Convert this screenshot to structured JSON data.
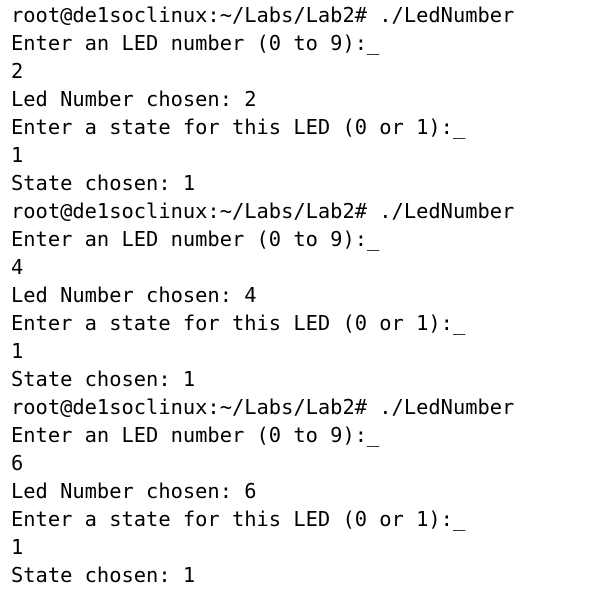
{
  "terminal": {
    "lines": [
      {
        "kind": "prompt",
        "text": "root@de1soclinux:~/Labs/Lab2# ./LedNumber"
      },
      {
        "kind": "output",
        "text": "Enter an LED number (0 to 9):_"
      },
      {
        "kind": "input",
        "text": "2"
      },
      {
        "kind": "output",
        "text": "Led Number chosen: 2"
      },
      {
        "kind": "output",
        "text": "Enter a state for this LED (0 or 1):_"
      },
      {
        "kind": "input",
        "text": "1"
      },
      {
        "kind": "output",
        "text": "State chosen: 1"
      },
      {
        "kind": "prompt",
        "text": "root@de1soclinux:~/Labs/Lab2# ./LedNumber"
      },
      {
        "kind": "output",
        "text": "Enter an LED number (0 to 9):_"
      },
      {
        "kind": "input",
        "text": "4"
      },
      {
        "kind": "output",
        "text": "Led Number chosen: 4"
      },
      {
        "kind": "output",
        "text": "Enter a state for this LED (0 or 1):_"
      },
      {
        "kind": "input",
        "text": "1"
      },
      {
        "kind": "output",
        "text": "State chosen: 1"
      },
      {
        "kind": "prompt",
        "text": "root@de1soclinux:~/Labs/Lab2# ./LedNumber"
      },
      {
        "kind": "output",
        "text": "Enter an LED number (0 to 9):_"
      },
      {
        "kind": "input",
        "text": "6"
      },
      {
        "kind": "output",
        "text": "Led Number chosen: 6"
      },
      {
        "kind": "output",
        "text": "Enter a state for this LED (0 or 1):_"
      },
      {
        "kind": "input",
        "text": "1"
      },
      {
        "kind": "output",
        "text": "State chosen: 1"
      }
    ]
  }
}
